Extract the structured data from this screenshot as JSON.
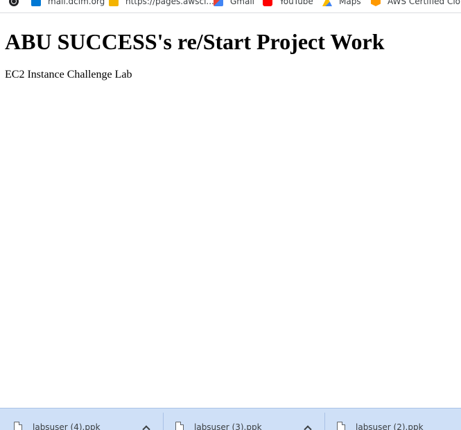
{
  "bookmarks": [
    {
      "label": "",
      "icon": "globe-icon"
    },
    {
      "label": "mail.dcim.org",
      "icon": "mail-icon"
    },
    {
      "label": "https://pages.awsci...",
      "icon": "folder-icon"
    },
    {
      "label": "Gmail",
      "icon": "gmail-icon"
    },
    {
      "label": "YouTube",
      "icon": "youtube-icon"
    },
    {
      "label": "Maps",
      "icon": "maps-icon"
    },
    {
      "label": "AWS Certified Clou...",
      "icon": "aws-icon"
    }
  ],
  "page": {
    "title": "ABU SUCCESS's re/Start Project Work",
    "subtitle": "EC2 Instance Challenge Lab"
  },
  "downloads": [
    {
      "file_name": "labsuser (4).ppk"
    },
    {
      "file_name": "labsuser (3).ppk"
    },
    {
      "file_name": "labsuser (2).ppk"
    }
  ],
  "colors": {
    "shelf_background": "#cfe0f7",
    "page_background": "#ffffff"
  }
}
